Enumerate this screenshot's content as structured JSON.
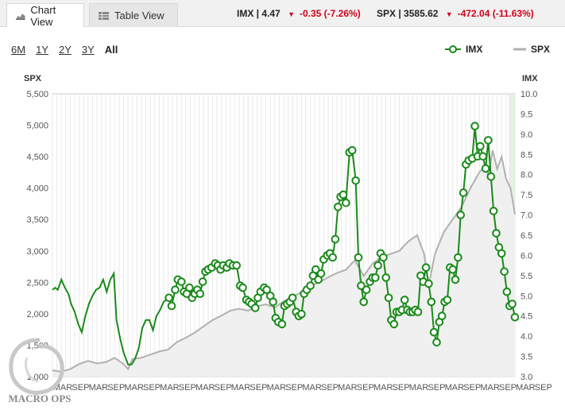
{
  "tabs": [
    {
      "label": "Chart View",
      "icon": "chart-icon",
      "active": true
    },
    {
      "label": "Table View",
      "icon": "table-icon",
      "active": false
    }
  ],
  "quotes": [
    {
      "symbol": "IMX",
      "value": "4.47",
      "change": "-0.35 (-7.26%)",
      "direction": "down"
    },
    {
      "symbol": "SPX",
      "value": "3585.62",
      "change": "-472.04 (-11.63%)",
      "direction": "down"
    }
  ],
  "colors": {
    "imx": "#1a8a1a",
    "spx": "#b0b0b0",
    "down": "#d0021b",
    "highlight": "#d9f2d9"
  },
  "range_buttons": [
    "6M",
    "1Y",
    "2Y",
    "3Y",
    "All"
  ],
  "selected_range": "All",
  "legend": [
    {
      "label": "IMX",
      "marker": "line-circle",
      "color": "#1a8a1a"
    },
    {
      "label": "SPX",
      "marker": "line",
      "color": "#b0b0b0"
    }
  ],
  "logo": {
    "text": "MACRO OPS"
  },
  "chart_data": {
    "type": "line",
    "left_axis": {
      "title": "SPX",
      "min": 1000,
      "max": 5500,
      "ticks": [
        "1,000",
        "1,500",
        "2,000",
        "2,500",
        "3,000",
        "3,500",
        "4,000",
        "4,500",
        "5,000",
        "5,500"
      ]
    },
    "right_axis": {
      "title": "IMX",
      "min": 3.0,
      "max": 10.0,
      "ticks": [
        "3.0",
        "3.5",
        "4.0",
        "4.5",
        "5.0",
        "5.5",
        "6.0",
        "6.5",
        "7.0",
        "7.5",
        "8.0",
        "8.5",
        "9.0",
        "9.5",
        "10.0"
      ]
    },
    "x_ticks": [
      "MAR",
      "SEP",
      "MAR",
      "SEP",
      "MAR",
      "SEP",
      "MAR",
      "SEP",
      "MAR",
      "SEP",
      "MAR",
      "SEP",
      "MAR",
      "SEP",
      "MAR",
      "SEP",
      "MAR",
      "SEP",
      "MAR",
      "SEP",
      "MAR",
      "SEP",
      "MAR",
      "SEP",
      "MAR",
      "SEP",
      "MAR",
      "SEP"
    ],
    "grid": true,
    "legend_position": "top-right",
    "imx_line": [
      [
        0,
        5.15
      ],
      [
        0.3,
        5.2
      ],
      [
        0.6,
        5.15
      ],
      [
        1.0,
        5.4
      ],
      [
        1.4,
        5.2
      ],
      [
        1.8,
        5.05
      ],
      [
        2.1,
        4.8
      ],
      [
        2.5,
        4.6
      ],
      [
        2.9,
        4.3
      ],
      [
        3.3,
        4.1
      ],
      [
        3.7,
        4.5
      ],
      [
        4.1,
        4.8
      ],
      [
        4.5,
        5.0
      ],
      [
        4.9,
        5.15
      ],
      [
        5.3,
        5.2
      ],
      [
        5.7,
        5.4
      ],
      [
        6.1,
        5.1
      ],
      [
        6.5,
        5.4
      ],
      [
        6.9,
        5.55
      ],
      [
        7.2,
        4.4
      ],
      [
        7.6,
        3.95
      ],
      [
        8.0,
        3.6
      ],
      [
        8.5,
        3.3
      ],
      [
        8.9,
        3.3
      ],
      [
        9.3,
        3.45
      ],
      [
        9.7,
        3.7
      ],
      [
        10.1,
        4.2
      ],
      [
        10.5,
        4.4
      ],
      [
        10.9,
        4.4
      ],
      [
        11.3,
        4.15
      ],
      [
        11.7,
        4.5
      ],
      [
        12.1,
        4.65
      ],
      [
        12.5,
        4.85
      ]
    ],
    "imx_markers": [
      [
        13.1,
        4.95
      ],
      [
        13.4,
        4.75
      ],
      [
        13.8,
        5.15
      ],
      [
        14.1,
        5.4
      ],
      [
        14.5,
        5.35
      ],
      [
        14.8,
        5.1
      ],
      [
        15.1,
        5.05
      ],
      [
        15.4,
        5.2
      ],
      [
        15.7,
        4.95
      ],
      [
        16.0,
        5.05
      ],
      [
        16.3,
        5.15
      ],
      [
        16.6,
        5.05
      ],
      [
        16.9,
        5.35
      ],
      [
        17.2,
        5.6
      ],
      [
        17.5,
        5.65
      ],
      [
        17.9,
        5.7
      ],
      [
        18.3,
        5.8
      ],
      [
        18.6,
        5.75
      ],
      [
        18.9,
        5.65
      ],
      [
        19.2,
        5.75
      ],
      [
        19.6,
        5.7
      ],
      [
        19.9,
        5.8
      ],
      [
        20.3,
        5.75
      ],
      [
        20.7,
        5.75
      ],
      [
        21.1,
        5.25
      ],
      [
        21.4,
        5.2
      ],
      [
        21.8,
        4.9
      ],
      [
        22.1,
        4.85
      ],
      [
        22.4,
        4.8
      ],
      [
        22.8,
        4.7
      ],
      [
        23.1,
        4.95
      ],
      [
        23.4,
        5.1
      ],
      [
        23.8,
        5.2
      ],
      [
        24.1,
        5.15
      ],
      [
        24.5,
        5.0
      ],
      [
        24.8,
        4.85
      ],
      [
        25.1,
        4.45
      ],
      [
        25.4,
        4.35
      ],
      [
        25.8,
        4.3
      ],
      [
        26.1,
        4.75
      ],
      [
        26.4,
        4.8
      ],
      [
        26.7,
        4.85
      ],
      [
        27.0,
        4.95
      ],
      [
        27.4,
        4.6
      ],
      [
        27.7,
        4.5
      ],
      [
        28.0,
        4.55
      ],
      [
        28.3,
        5.05
      ],
      [
        28.6,
        5.15
      ],
      [
        29.0,
        5.25
      ],
      [
        29.3,
        5.5
      ],
      [
        29.6,
        5.65
      ],
      [
        29.9,
        5.4
      ],
      [
        30.2,
        5.55
      ],
      [
        30.5,
        5.9
      ],
      [
        30.9,
        6.0
      ],
      [
        31.2,
        6.05
      ],
      [
        31.5,
        5.95
      ],
      [
        31.8,
        6.4
      ],
      [
        32.1,
        7.2
      ],
      [
        32.4,
        7.45
      ],
      [
        32.7,
        7.5
      ],
      [
        33.0,
        7.3
      ],
      [
        33.4,
        8.55
      ],
      [
        33.7,
        8.6
      ],
      [
        34.1,
        7.85
      ],
      [
        34.4,
        5.95
      ],
      [
        34.7,
        5.25
      ],
      [
        35.0,
        4.85
      ],
      [
        35.3,
        5.15
      ],
      [
        35.7,
        5.35
      ],
      [
        36.0,
        5.45
      ],
      [
        36.3,
        5.45
      ],
      [
        36.6,
        5.75
      ],
      [
        36.9,
        6.05
      ],
      [
        37.2,
        5.95
      ],
      [
        37.5,
        5.45
      ],
      [
        37.8,
        4.95
      ],
      [
        38.1,
        4.4
      ],
      [
        38.4,
        4.3
      ],
      [
        38.7,
        4.6
      ],
      [
        39.0,
        4.6
      ],
      [
        39.3,
        4.65
      ],
      [
        39.6,
        4.9
      ],
      [
        39.9,
        4.65
      ],
      [
        40.2,
        4.6
      ],
      [
        40.5,
        4.6
      ],
      [
        40.8,
        4.65
      ],
      [
        41.1,
        4.6
      ],
      [
        41.4,
        5.5
      ],
      [
        41.7,
        5.35
      ],
      [
        42.0,
        5.7
      ],
      [
        42.3,
        5.3
      ],
      [
        42.6,
        4.85
      ],
      [
        42.9,
        4.1
      ],
      [
        43.2,
        3.85
      ],
      [
        43.5,
        4.35
      ],
      [
        43.8,
        4.5
      ],
      [
        44.1,
        4.85
      ],
      [
        44.4,
        4.9
      ],
      [
        44.7,
        5.7
      ],
      [
        45.0,
        5.65
      ],
      [
        45.3,
        5.4
      ],
      [
        45.6,
        5.95
      ],
      [
        45.9,
        7.0
      ],
      [
        46.2,
        7.55
      ],
      [
        46.5,
        8.25
      ],
      [
        46.8,
        8.35
      ],
      [
        47.2,
        8.4
      ],
      [
        47.5,
        9.2
      ],
      [
        47.8,
        8.45
      ],
      [
        48.1,
        8.7
      ],
      [
        48.4,
        8.45
      ],
      [
        48.7,
        8.15
      ],
      [
        49.0,
        8.85
      ],
      [
        49.3,
        7.95
      ],
      [
        49.6,
        7.1
      ],
      [
        49.9,
        6.55
      ],
      [
        50.2,
        6.2
      ],
      [
        50.5,
        6.05
      ],
      [
        50.8,
        5.6
      ],
      [
        51.1,
        5.1
      ],
      [
        51.4,
        4.75
      ],
      [
        51.7,
        4.8
      ],
      [
        52.0,
        4.47
      ]
    ],
    "spx_line": [
      [
        0,
        1100
      ],
      [
        1,
        1080
      ],
      [
        2,
        1120
      ],
      [
        3,
        1200
      ],
      [
        4,
        1250
      ],
      [
        5,
        1210
      ],
      [
        6,
        1230
      ],
      [
        7,
        1300
      ],
      [
        8,
        1200
      ],
      [
        8.5,
        1120
      ],
      [
        9,
        1280
      ],
      [
        10,
        1300
      ],
      [
        11,
        1350
      ],
      [
        12,
        1400
      ],
      [
        13,
        1430
      ],
      [
        14,
        1550
      ],
      [
        15,
        1620
      ],
      [
        16,
        1700
      ],
      [
        17,
        1800
      ],
      [
        18,
        1900
      ],
      [
        19,
        1970
      ],
      [
        20,
        2050
      ],
      [
        21,
        2080
      ],
      [
        22,
        2050
      ],
      [
        23,
        2120
      ],
      [
        24,
        2150
      ],
      [
        25,
        2100
      ],
      [
        26,
        2200
      ],
      [
        27,
        2260
      ],
      [
        28,
        2350
      ],
      [
        29,
        2450
      ],
      [
        30,
        2500
      ],
      [
        31,
        2580
      ],
      [
        32,
        2650
      ],
      [
        33,
        2700
      ],
      [
        34,
        2850
      ],
      [
        34.6,
        2700
      ],
      [
        35,
        2600
      ],
      [
        36,
        2800
      ],
      [
        37,
        2900
      ],
      [
        38,
        2950
      ],
      [
        39,
        3000
      ],
      [
        40,
        3150
      ],
      [
        41,
        3250
      ],
      [
        41.8,
        2950
      ],
      [
        42.3,
        2450
      ],
      [
        43,
        2950
      ],
      [
        44,
        3300
      ],
      [
        45,
        3500
      ],
      [
        46,
        3700
      ],
      [
        47,
        4000
      ],
      [
        48,
        4250
      ],
      [
        48.6,
        4350
      ],
      [
        49,
        4200
      ],
      [
        49.5,
        4600
      ],
      [
        50,
        4300
      ],
      [
        50.5,
        4500
      ],
      [
        51,
        4150
      ],
      [
        51.5,
        4000
      ],
      [
        52,
        3585.62
      ]
    ]
  }
}
